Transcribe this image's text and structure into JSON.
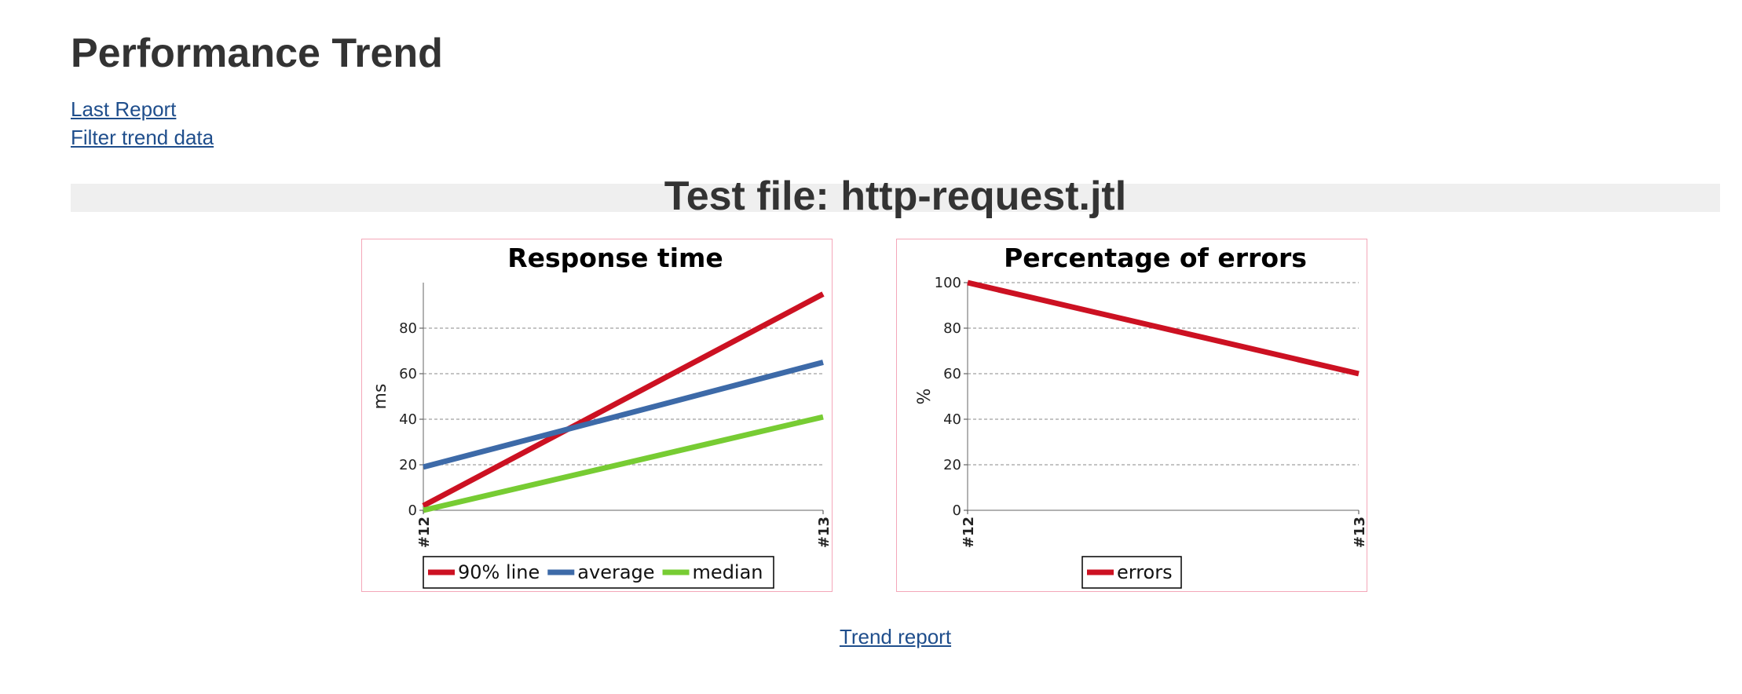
{
  "page": {
    "title": "Performance Trend",
    "links": [
      "Last Report",
      "Filter trend data"
    ],
    "section_title": "Test file: http-request.jtl",
    "footer_link": "Trend report"
  },
  "chart_data": [
    {
      "type": "line",
      "title": "Response time",
      "ylabel": "ms",
      "xlabel": "",
      "x": [
        "#12",
        "#13"
      ],
      "ylim": [
        0,
        100
      ],
      "yticks": [
        0,
        20,
        40,
        60,
        80
      ],
      "grid": true,
      "legend": "bottom",
      "series": [
        {
          "name": "90% line",
          "values": [
            2,
            95
          ],
          "color": "#cc1122"
        },
        {
          "name": "average",
          "values": [
            19,
            65
          ],
          "color": "#3d6aa8"
        },
        {
          "name": "median",
          "values": [
            0,
            41
          ],
          "color": "#77cc33"
        }
      ]
    },
    {
      "type": "line",
      "title": "Percentage of errors",
      "ylabel": "%",
      "xlabel": "",
      "x": [
        "#12",
        "#13"
      ],
      "ylim": [
        0,
        100
      ],
      "yticks": [
        0,
        20,
        40,
        60,
        80,
        100
      ],
      "grid": true,
      "legend": "bottom",
      "series": [
        {
          "name": "errors",
          "values": [
            100,
            60
          ],
          "color": "#cc1122"
        }
      ]
    }
  ]
}
